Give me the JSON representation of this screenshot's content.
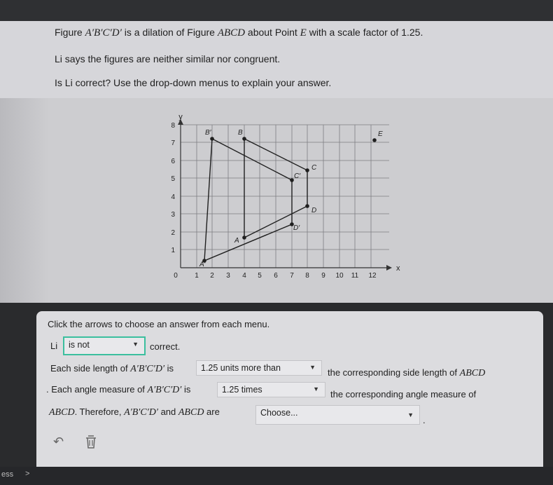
{
  "question": {
    "line1_pre": "Figure ",
    "line1_fig1": "A′B′C′D′",
    "line1_mid": " is a dilation of Figure ",
    "line1_fig2": "ABCD",
    "line1_mid2": " about Point ",
    "line1_point": "E",
    "line1_post": " with a scale factor of 1.25.",
    "line2": "Li says the figures are neither similar nor congruent.",
    "line3": "Is Li correct? Use the drop-down menus to explain your answer."
  },
  "graph": {
    "y_axis_label": "y",
    "x_axis_label": "x",
    "x_ticks": [
      "0",
      "1",
      "2",
      "3",
      "4",
      "5",
      "6",
      "7",
      "8",
      "9",
      "10",
      "11",
      "12"
    ],
    "y_ticks": [
      "1",
      "2",
      "3",
      "4",
      "5",
      "6",
      "7",
      "8"
    ],
    "point_labels": {
      "B1": "B′",
      "B": "B",
      "E": "E",
      "C": "C",
      "C1": "C′",
      "D": "D",
      "D1": "D′",
      "A": "A",
      "A1": "A′"
    }
  },
  "answer": {
    "instruction": "Click the arrows to choose an answer from each menu.",
    "li_label": "Li",
    "dropdown1": "is not",
    "correct_text": "correct.",
    "side_pre": "Each side length of ",
    "side_fig": "A′B′C′D′",
    "side_is": " is",
    "dropdown2": "1.25 units more than",
    "side_post_pre": "the corresponding side length of ",
    "side_post_fig": "ABCD",
    "angle_pre": ". Each angle measure of ",
    "angle_fig": "A′B′C′D′",
    "angle_is": " is",
    "dropdown3": "1.25 times",
    "angle_post": "the corresponding angle measure of",
    "final_fig1": "ABCD",
    "final_mid": ". Therefore, ",
    "final_fig2": "A′B′C′D′",
    "final_and": " and ",
    "final_fig3": "ABCD",
    "final_are": " are",
    "dropdown4": "Choose...",
    "final_dot": "."
  },
  "footer": {
    "left_text": "ess",
    "arrow": ">"
  }
}
